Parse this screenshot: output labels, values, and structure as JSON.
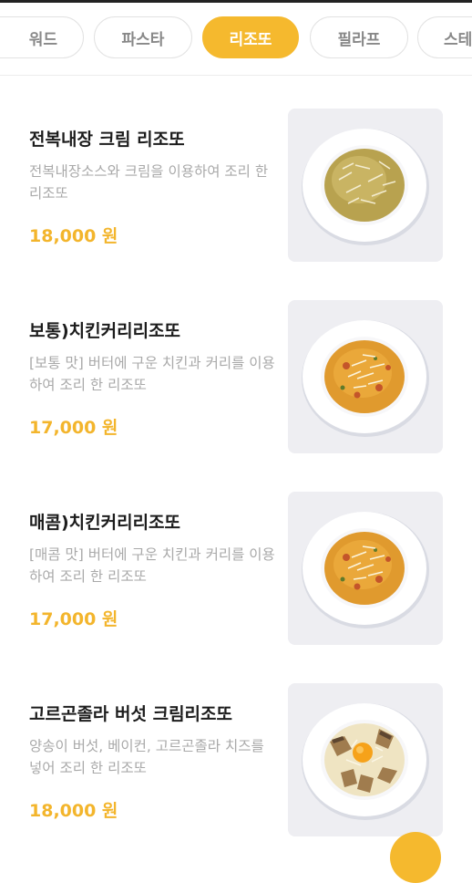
{
  "category_tabs": [
    {
      "label": "워드",
      "active": false
    },
    {
      "label": "파스타",
      "active": false
    },
    {
      "label": "리조또",
      "active": true
    },
    {
      "label": "필라프",
      "active": false
    },
    {
      "label": "스테",
      "active": false
    }
  ],
  "menu_items": [
    {
      "title": "전복내장 크림 리조또",
      "description": "전복내장소스와 크림을 이용하여 조리 한 리조또",
      "price": "18,000 원",
      "image": "cream-risotto"
    },
    {
      "title": "보통)치킨커리리조또",
      "description": "[보통 맛] 버터에 구운 치킨과 커리를 이용하여 조리 한 리조또",
      "price": "17,000 원",
      "image": "curry-risotto"
    },
    {
      "title": "매콤)치킨커리리조또",
      "description": "[매콤 맛] 버터에 구운 치킨과 커리를 이용하여 조리 한 리조또",
      "price": "17,000 원",
      "image": "curry-risotto"
    },
    {
      "title": "고르곤졸라 버섯 크림리조또",
      "description": "양송이 버섯, 베이컨, 고르곤졸라 치즈를 넣어 조리 한 리조또",
      "price": "18,000 원",
      "image": "mushroom-egg-risotto"
    }
  ],
  "colors": {
    "accent": "#f5b92e",
    "title": "#1c1c1c",
    "description": "#a9a9a9"
  }
}
